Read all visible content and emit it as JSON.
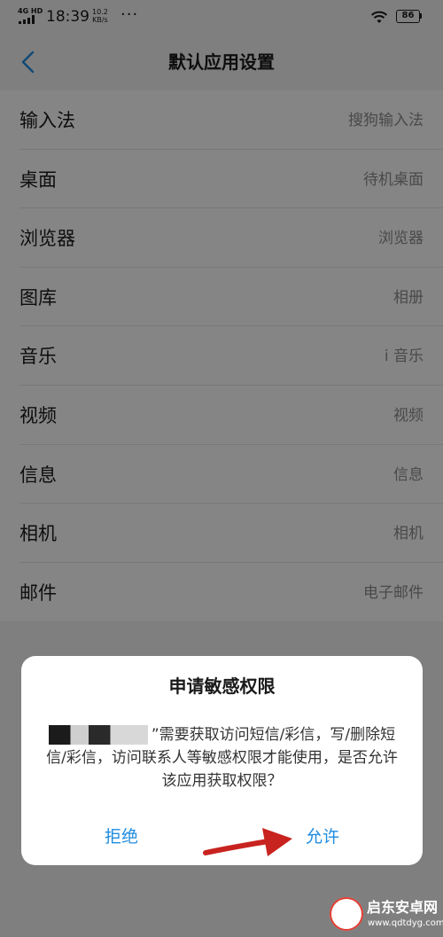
{
  "status_bar": {
    "network": "4G HD",
    "time": "18:39",
    "speed_value": "10.2",
    "speed_unit": "KB/s",
    "more_dots": "···",
    "battery": "86"
  },
  "header": {
    "title": "默认应用设置"
  },
  "settings": {
    "items": [
      {
        "label": "输入法",
        "value": "搜狗输入法"
      },
      {
        "label": "桌面",
        "value": "待机桌面"
      },
      {
        "label": "浏览器",
        "value": "浏览器"
      },
      {
        "label": "图库",
        "value": "相册"
      },
      {
        "label": "音乐",
        "value": "i 音乐"
      },
      {
        "label": "视频",
        "value": "视频"
      },
      {
        "label": "信息",
        "value": "信息"
      },
      {
        "label": "相机",
        "value": "相机"
      },
      {
        "label": "邮件",
        "value": "电子邮件"
      }
    ]
  },
  "dialog": {
    "title": "申请敏感权限",
    "message": "”需要获取访问短信/彩信，写/删除短信/彩信，访问联系人等敏感权限才能使用，是否允许该应用获取权限？",
    "deny_label": "拒绝",
    "allow_label": "允许"
  },
  "watermark": {
    "name": "启东安卓网",
    "url": "www.qdtdyg.com"
  },
  "colors": {
    "accent": "#1f8ce0",
    "arrow": "#c8231f",
    "scrim": "rgba(0,0,0,0.48)"
  }
}
